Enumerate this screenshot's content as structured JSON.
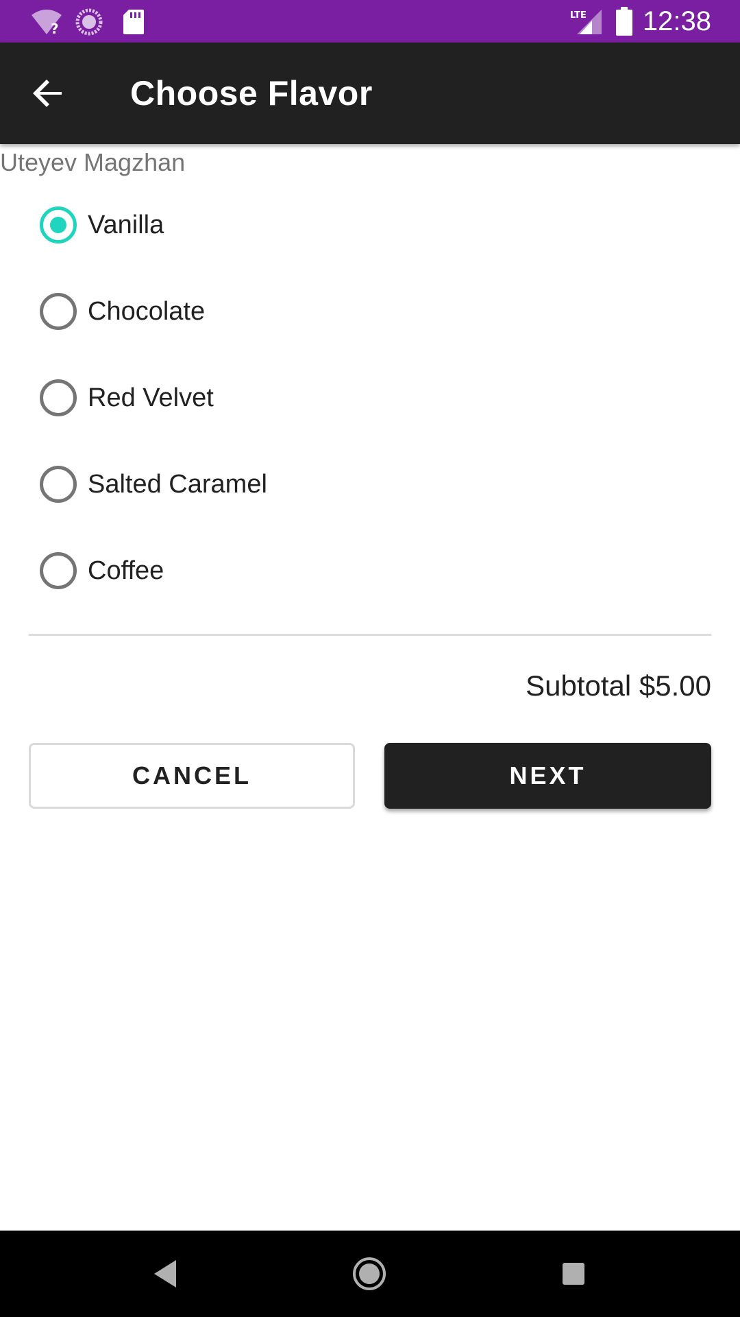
{
  "status_bar": {
    "time": "12:38",
    "network_label": "LTE",
    "icons": [
      "wifi-unknown-icon",
      "sync-icon",
      "sd-card-icon",
      "signal-lte-icon",
      "battery-icon"
    ]
  },
  "app_bar": {
    "title": "Choose Flavor",
    "back_icon": "arrow-back-icon"
  },
  "content": {
    "author": "Uteyev Magzhan",
    "flavors": [
      {
        "label": "Vanilla",
        "selected": true
      },
      {
        "label": "Chocolate",
        "selected": false
      },
      {
        "label": "Red Velvet",
        "selected": false
      },
      {
        "label": "Salted Caramel",
        "selected": false
      },
      {
        "label": "Coffee",
        "selected": false
      }
    ],
    "subtotal": "Subtotal $5.00",
    "cancel_label": "CANCEL",
    "next_label": "NEXT"
  },
  "colors": {
    "status_bar": "#7b1fa2",
    "app_bar": "#212121",
    "radio_accent": "#20d5c0",
    "nav_bar": "#000000"
  },
  "nav_bar": {
    "icons": [
      "nav-back-icon",
      "nav-home-icon",
      "nav-recents-icon"
    ]
  }
}
